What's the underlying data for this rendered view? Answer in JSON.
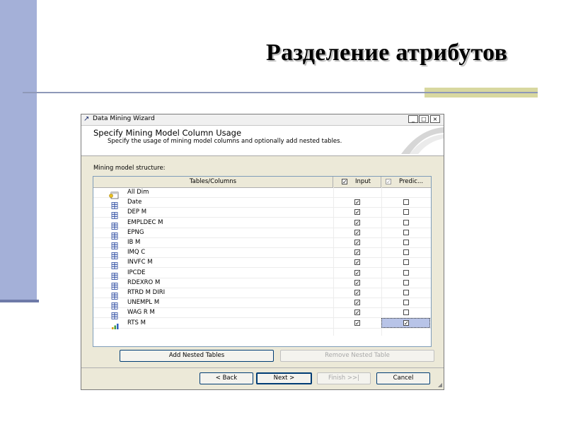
{
  "slide": {
    "title": "Разделение атрибутов"
  },
  "window": {
    "title": "Data Mining Wizard",
    "controls": {
      "minimize": "_",
      "maximize": "□",
      "close": "×"
    },
    "header_title": "Specify Mining Model Column Usage",
    "header_subtitle": "Specify the usage of mining model columns and optionally add nested tables.",
    "structure_label": "Mining model structure:",
    "columns": {
      "tables_columns": "Tables/Columns",
      "input": "Input",
      "predict": "Predic..."
    },
    "rows": [
      {
        "label": "All Dim",
        "icon": "dimension-table-icon",
        "input": null,
        "predict": null
      },
      {
        "label": "Date",
        "icon": "column-icon",
        "input": true,
        "predict": false
      },
      {
        "label": "DEP M",
        "icon": "column-icon",
        "input": true,
        "predict": false
      },
      {
        "label": "EMPLDEC M",
        "icon": "column-icon",
        "input": true,
        "predict": false
      },
      {
        "label": "EPNG",
        "icon": "column-icon",
        "input": true,
        "predict": false
      },
      {
        "label": "IB M",
        "icon": "column-icon",
        "input": true,
        "predict": false
      },
      {
        "label": "IMQ C",
        "icon": "column-icon",
        "input": true,
        "predict": false
      },
      {
        "label": "INVFC M",
        "icon": "column-icon",
        "input": true,
        "predict": false
      },
      {
        "label": "IPCDE",
        "icon": "column-icon",
        "input": true,
        "predict": false
      },
      {
        "label": "RDEXRO M",
        "icon": "column-icon",
        "input": true,
        "predict": false
      },
      {
        "label": "RTRD M DIRI",
        "icon": "column-icon",
        "input": true,
        "predict": false
      },
      {
        "label": "UNEMPL M",
        "icon": "column-icon",
        "input": true,
        "predict": false
      },
      {
        "label": "WAG R M",
        "icon": "column-icon",
        "input": true,
        "predict": false
      },
      {
        "label": "RTS M",
        "icon": "measure-icon",
        "input": true,
        "predict": true
      }
    ],
    "buttons": {
      "add_nested": "Add Nested Tables",
      "remove_nested": "Remove Nested Table",
      "back": "< Back",
      "next": "Next >",
      "finish": "Finish >>|",
      "cancel": "Cancel"
    }
  },
  "colors": {
    "left_bar": "#a4b0d8",
    "title_line": "#8e98b8",
    "accent": "#d8d8a0",
    "selection": "#b8c4e8"
  }
}
